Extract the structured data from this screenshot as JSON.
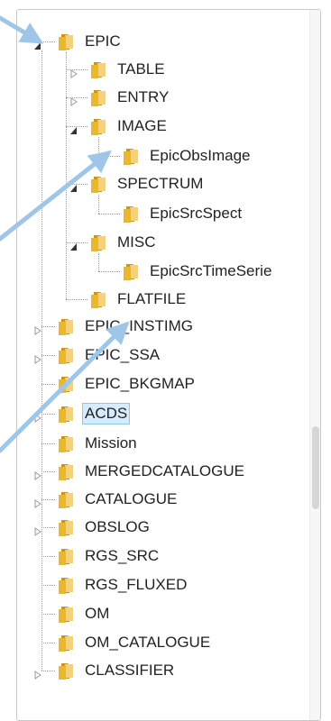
{
  "tree": {
    "nodes": [
      {
        "label": "EPIC",
        "state": "expanded"
      },
      {
        "label": "TABLE",
        "state": "collapsed"
      },
      {
        "label": "ENTRY",
        "state": "collapsed"
      },
      {
        "label": "IMAGE",
        "state": "expanded"
      },
      {
        "label": "EpicObsImage",
        "state": "leaf"
      },
      {
        "label": "SPECTRUM",
        "state": "expanded"
      },
      {
        "label": "EpicSrcSpect",
        "state": "leaf"
      },
      {
        "label": "MISC",
        "state": "expanded"
      },
      {
        "label": "EpicSrcTimeSerie",
        "state": "leaf"
      },
      {
        "label": "FLATFILE",
        "state": "leaf"
      },
      {
        "label": "EPIC_INSTIMG",
        "state": "collapsed"
      },
      {
        "label": "EPIC_SSA",
        "state": "collapsed"
      },
      {
        "label": "EPIC_BKGMAP",
        "state": "leaf"
      },
      {
        "label": "ACDS",
        "state": "collapsed",
        "selected": true
      },
      {
        "label": "Mission",
        "state": "leaf"
      },
      {
        "label": "MERGEDCATALOGUE",
        "state": "collapsed"
      },
      {
        "label": "CATALOGUE",
        "state": "collapsed"
      },
      {
        "label": "OBSLOG",
        "state": "collapsed"
      },
      {
        "label": "RGS_SRC",
        "state": "leaf"
      },
      {
        "label": "RGS_FLUXED",
        "state": "leaf"
      },
      {
        "label": "OM",
        "state": "leaf"
      },
      {
        "label": "OM_CATALOGUE",
        "state": "leaf"
      },
      {
        "label": "CLASSIFIER",
        "state": "collapsed"
      }
    ]
  },
  "colors": {
    "folder": "#e8b832",
    "arrow": "#9fc6e8",
    "selection": "#d6ebfb"
  },
  "icons": {
    "folder": "folder-icon",
    "expanded": "expanded-triangle-icon",
    "collapsed": "collapsed-triangle-icon"
  }
}
